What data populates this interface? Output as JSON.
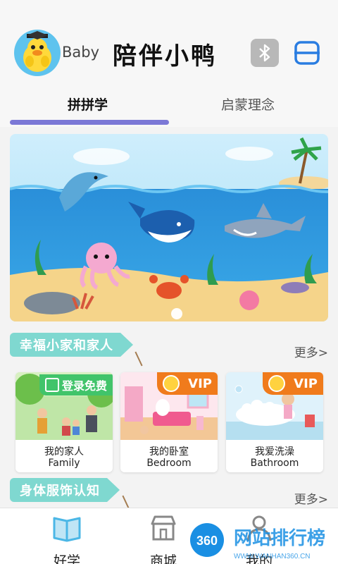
{
  "header": {
    "baby_label": "Baby",
    "app_title": "陪伴小鸭",
    "avatar_icon": "duckling-avatar-icon",
    "bluetooth_icon": "bluetooth-icon",
    "scan_icon": "scan-icon"
  },
  "tabs": [
    {
      "label": "拼拼学",
      "active": true
    },
    {
      "label": "启蒙理念",
      "active": false
    }
  ],
  "banner": {
    "scene": "ocean-illustration"
  },
  "sections": [
    {
      "title": "幸福小家和家人",
      "more": "更多>",
      "cards": [
        {
          "title": "我的家人",
          "subtitle": "Family",
          "badge": "登录免费",
          "badge_type": "free"
        },
        {
          "title": "我的卧室",
          "subtitle": "Bedroom",
          "badge": "VIP",
          "badge_type": "vip"
        },
        {
          "title": "我爱洗澡",
          "subtitle": "Bathroom",
          "badge": "VIP",
          "badge_type": "vip"
        }
      ]
    },
    {
      "title": "身体服饰认知",
      "more": "更多>"
    }
  ],
  "bottom_nav": [
    {
      "label": "好学",
      "icon": "book-icon"
    },
    {
      "label": "商城",
      "icon": "shop-icon"
    },
    {
      "label": "我的",
      "icon": "profile-icon"
    }
  ],
  "watermark": {
    "badge": "360",
    "text": "网站排行榜",
    "url": "WWW.WANHAN360.CN"
  },
  "colors": {
    "accent": "#7b78d6",
    "tag": "#7fd8d0",
    "vip": "#f07b1c",
    "free": "#41c46a",
    "nav_icon": "#4bb7e6"
  }
}
